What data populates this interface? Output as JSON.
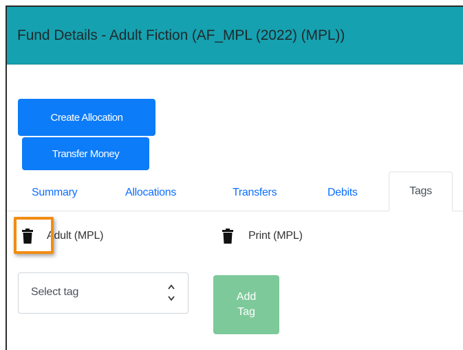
{
  "header": {
    "title": "Fund Details - Adult Fiction (AF_MPL (2022) (MPL))"
  },
  "actions": {
    "create_allocation": "Create Allocation",
    "transfer_money": "Transfer Money"
  },
  "tabs": [
    {
      "label": "Summary"
    },
    {
      "label": "Allocations"
    },
    {
      "label": "Transfers"
    },
    {
      "label": "Debits"
    },
    {
      "label": "Tags",
      "active": true
    }
  ],
  "tags": [
    {
      "label": "Adult (MPL)",
      "icon": "trash-icon"
    },
    {
      "label": "Print (MPL)",
      "icon": "trash-icon"
    }
  ],
  "tag_select": {
    "placeholder": "Select tag"
  },
  "add_tag": {
    "line1": "Add",
    "line2": "Tag"
  },
  "colors": {
    "header": "#16a1b0",
    "primary": "#0d7cf8",
    "success": "#7dc99a",
    "highlight": "#f28c13"
  }
}
